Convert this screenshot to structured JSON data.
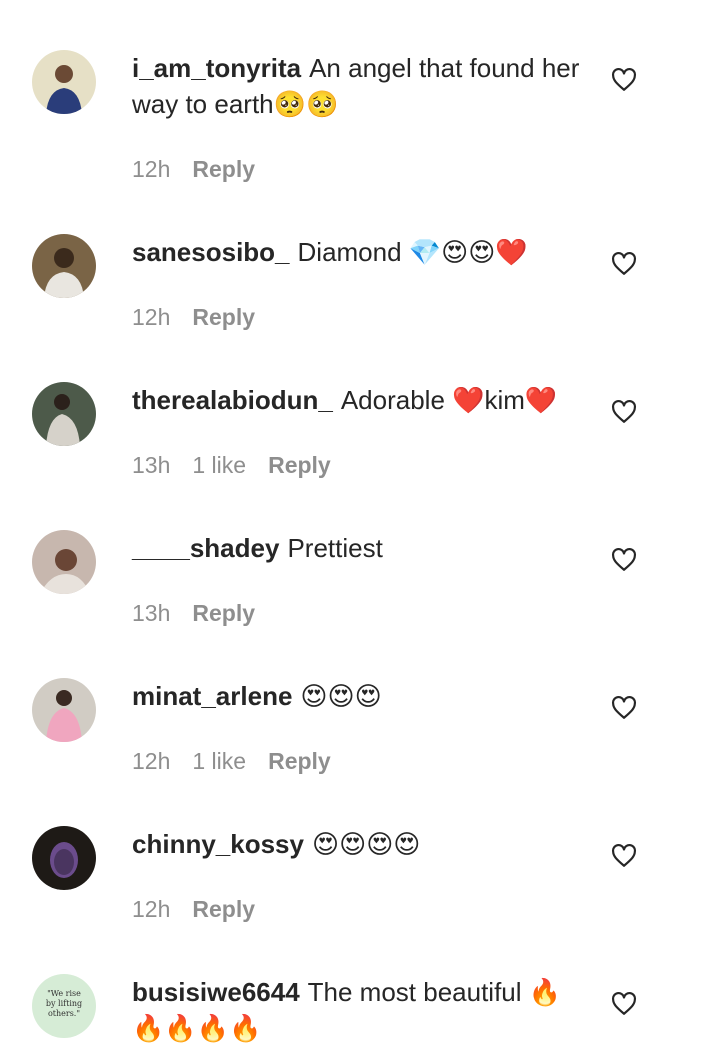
{
  "comments": [
    {
      "username": "i_am_tonyrita",
      "text": "An angel that found her way to earth🥺🥺",
      "time": "12h",
      "likes": "",
      "reply": "Reply",
      "avatar_color": "#d9d3b8"
    },
    {
      "username": "sanesosibo_",
      "text": "Diamond 💎😍😍❤️",
      "time": "12h",
      "likes": "",
      "reply": "Reply",
      "avatar_color": "#6f5b3c"
    },
    {
      "username": "therealabiodun_",
      "text": "Adorable ❤️kim❤️",
      "time": "13h",
      "likes": "1 like",
      "reply": "Reply",
      "avatar_color": "#5a5a4c"
    },
    {
      "username": "____shadey",
      "text": "Prettiest",
      "time": "13h",
      "likes": "",
      "reply": "Reply",
      "avatar_color": "#b8a6a0"
    },
    {
      "username": "minat_arlene",
      "text": "😍😍😍",
      "time": "12h",
      "likes": "1 like",
      "reply": "Reply",
      "avatar_color": "#c9c4bc"
    },
    {
      "username": "chinny_kossy",
      "text": "😍😍😍😍",
      "time": "12h",
      "likes": "",
      "reply": "Reply",
      "avatar_color": "#2e2620"
    },
    {
      "username": "busisiwe6644",
      "text": "The most beautiful 🔥🔥🔥🔥🔥",
      "time": "",
      "likes": "",
      "reply": "",
      "avatar_color": "#cfe6cf",
      "avatar_caption": [
        "\"We rise",
        "by lifting",
        "others.\""
      ]
    }
  ]
}
